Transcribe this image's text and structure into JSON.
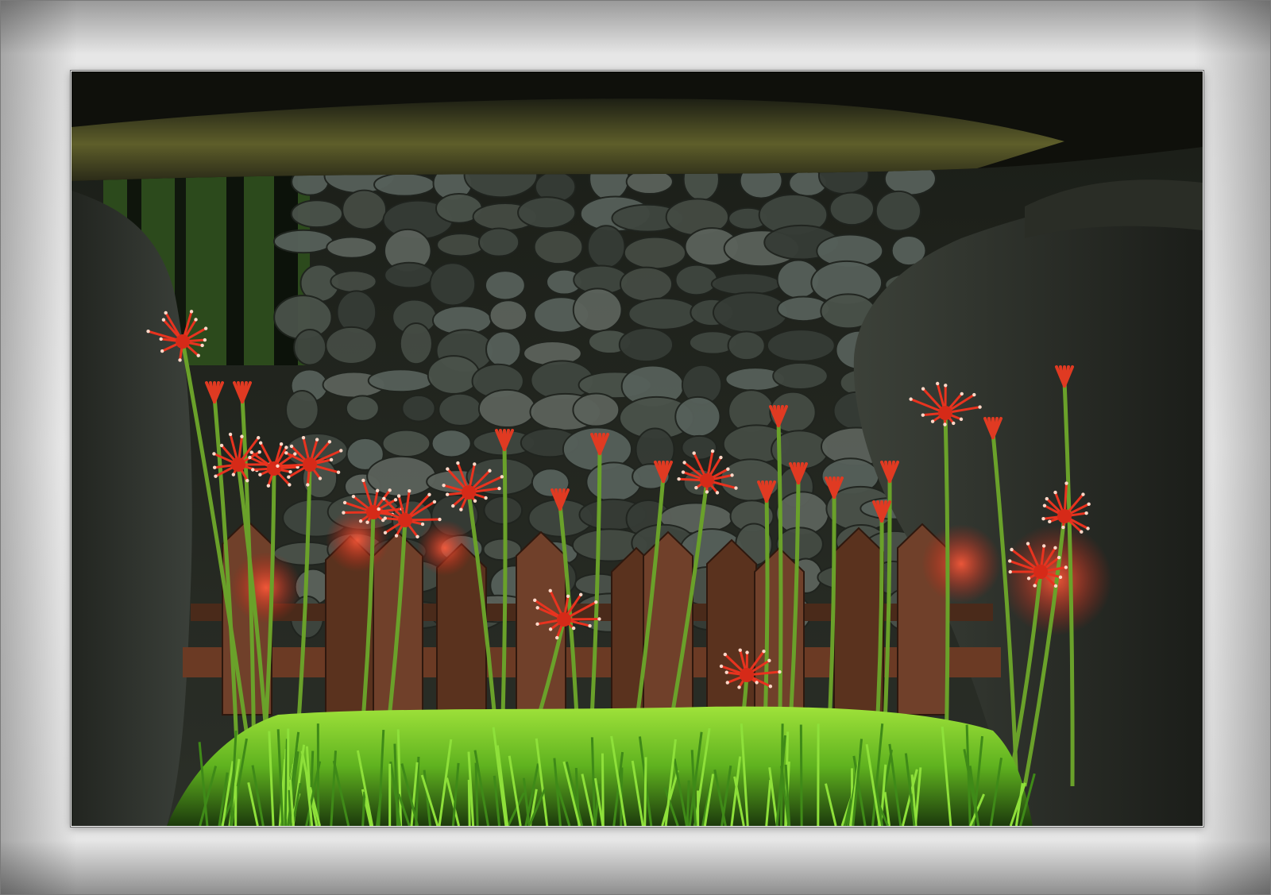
{
  "scene": {
    "subject": "red-spider-lilies",
    "elements": [
      "stone-lintel",
      "stone-wall",
      "wooden-picket-fence",
      "red-spider-lily-flowers",
      "green-grass",
      "standing-stones"
    ],
    "palette": {
      "mat": "#e8e8e8",
      "shadow": "#141611",
      "moss": "#5e5e2a",
      "stone": "#4a524a",
      "fence": "#6b3a24",
      "flower": "#e8331f",
      "stem": "#6aa12a",
      "grass": "#7ecf2a"
    }
  }
}
